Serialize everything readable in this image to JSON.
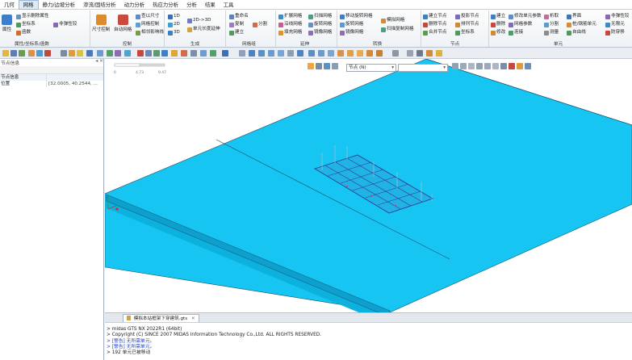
{
  "menu": {
    "tabs": [
      "几何",
      "网格",
      "静力/边坡分析",
      "渗流/固结分析",
      "动力分析",
      "热应力分析",
      "分析",
      "结果",
      "工具"
    ],
    "active_index": 1
  },
  "ribbon": {
    "groups": [
      {
        "label": "属性/坐标系/函数",
        "big": "属性",
        "items": [
          "显示删除属性",
          "坐标系",
          "函数",
          "非弹性铰"
        ]
      },
      {
        "label": "控制",
        "big1": "尺寸控制",
        "big2": "自动网格",
        "items": [
          "查以尺寸",
          "网格控制",
          "相邻影响线"
        ]
      },
      {
        "label": "生成",
        "items": [
          "1D",
          "2D",
          "3D",
          "2D->3D",
          "单元长度延伸"
        ]
      },
      {
        "label": "网格组",
        "items": [
          "重命名",
          "复制",
          "分割",
          "建立"
        ]
      },
      {
        "label": "延伸",
        "items": [
          "扩展网格",
          "沿线网格",
          "填充网格",
          "扫描网格",
          "旋转网格",
          "镜像网格"
        ]
      },
      {
        "label": "转换",
        "items": [
          "移动旋转网格",
          "旋转网格",
          "镜像网格",
          "模拟网格",
          "扫描复制网格"
        ]
      },
      {
        "label": "节点",
        "items": [
          "建立节点",
          "删除节点",
          "合并节点",
          "投影节点",
          "排列节点",
          "坐标系"
        ]
      },
      {
        "label": "单元",
        "items": [
          "建立",
          "删除",
          "修改",
          "修改单元参数",
          "网格参数",
          "连接",
          "析取",
          "分割",
          "测量",
          "界面",
          "桩/钢筋单元",
          "自由线",
          "非弹性铰",
          "无限元",
          "防穿移"
        ]
      }
    ]
  },
  "left_panel": {
    "header": "节点信息",
    "rows": [
      {
        "key": "节点信息",
        "value": ""
      },
      {
        "key": "位置",
        "value": "[32.0005, 40.2544, ..."
      }
    ]
  },
  "viewport": {
    "dropdown_value": "节点 (N)",
    "dropdown2_value": "",
    "scale_labels": [
      "0",
      "4.73",
      "9.47"
    ]
  },
  "doc_tab": {
    "label": "模拟本站框架下穿建筑.gts"
  },
  "console": {
    "lines": [
      {
        "text": "> midas GTS NX 2022R1 (64bit)",
        "warn": false
      },
      {
        "text": "> Copyright (C) SINCE 2007 MIDAS Information Technology Co.,Ltd. ALL RIGHTS RESERVED.",
        "warn": false
      },
      {
        "text": "> [警告] 无所需单元。",
        "warn": true
      },
      {
        "text": "> [警告] 无所需单元。",
        "warn": true
      },
      {
        "text": "> 192 单元已被移动",
        "warn": false
      }
    ]
  },
  "colors": {
    "model_top": "#16c5f2",
    "model_front": "#0db1de",
    "model_side": "#0a9fcc",
    "mesh_line": "#2a3c9a",
    "edge_line": "#1b4f6a"
  }
}
